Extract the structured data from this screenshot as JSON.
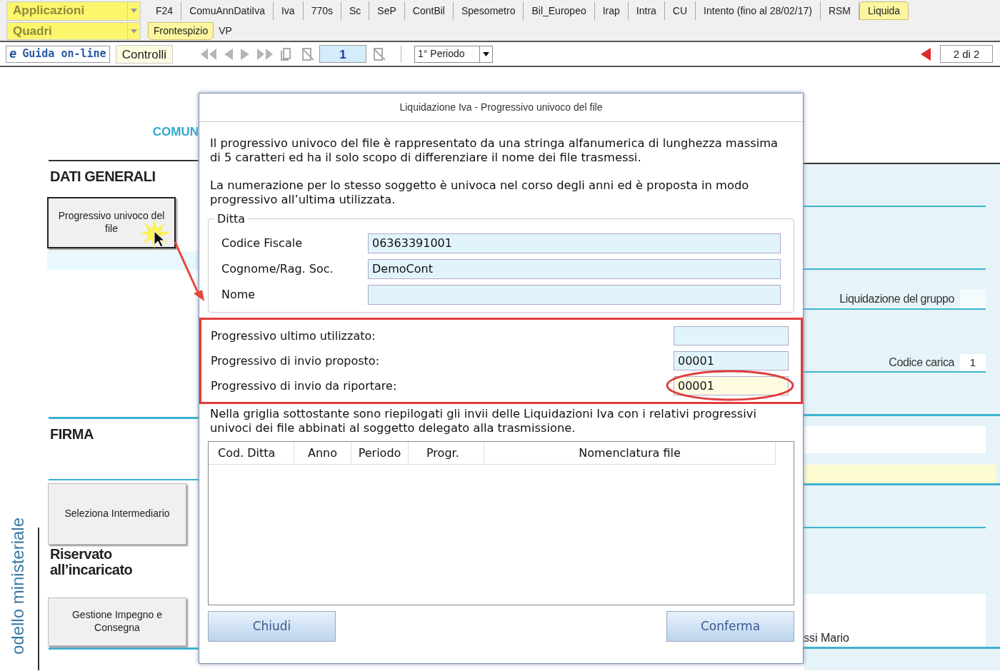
{
  "toolbar": {
    "applications_select": "Applicazioni",
    "sections_select": "Quadri",
    "tabs": [
      {
        "label": "F24",
        "selected": false
      },
      {
        "label": "ComuAnnDatiIva",
        "selected": false
      },
      {
        "label": "Iva",
        "selected": false
      },
      {
        "label": "770s",
        "selected": false
      },
      {
        "label": "Sc",
        "selected": false
      },
      {
        "label": "SeP",
        "selected": false
      },
      {
        "label": "ContBil",
        "selected": false
      },
      {
        "label": "Spesometro",
        "selected": false
      },
      {
        "label": "Bil_Europeo",
        "selected": false
      },
      {
        "label": "Irap",
        "selected": false
      },
      {
        "label": "Intra",
        "selected": false
      },
      {
        "label": "CU",
        "selected": false
      },
      {
        "label": "Intento (fino al 28/02/17)",
        "selected": false
      },
      {
        "label": "RSM",
        "selected": false
      },
      {
        "label": "Liquida",
        "selected": true
      }
    ],
    "sub_tabs": [
      {
        "label": "Frontespizio",
        "selected": true
      },
      {
        "label": "VP",
        "selected": false
      }
    ],
    "help_button": {
      "icon": "e",
      "label": "Guida on-line"
    },
    "checks_button": "Controlli",
    "page_field": "1",
    "period_select": "1° Periodo",
    "page_count": "2 di 2"
  },
  "form": {
    "logo_text": "COMUN",
    "general_title": "DATI GENERALI",
    "progressive_button": "Progressivo univoco del file",
    "signature_title": "FIRMA",
    "intermediary_button": "Seleziona Intermediario",
    "reserved_title": "Riservato all’incaricato",
    "commitment_button": "Gestione Impegno e Consegna",
    "side_label": "odello ministeriale",
    "group_label": "Liquidazione del gruppo",
    "role_label": "Codice carica",
    "role_value": "1",
    "name_fragment": "ssi Mario"
  },
  "dialog": {
    "title": "Liquidazione Iva - Progressivo univoco del file",
    "paragraphs": [
      "Il progressivo univoco del file è rappresentato da una stringa alfanumerica di lunghezza massima di 5 caratteri ed ha il solo scopo di differenziare il nome dei file trasmessi.",
      "La numerazione per lo stesso soggetto è univoca nel corso degli anni ed è proposta in modo progressivo all’ultima utilizzata."
    ],
    "company": {
      "legend": "Ditta",
      "fields": [
        {
          "label": "Codice Fiscale",
          "value": "06363391001"
        },
        {
          "label": "Cognome/Rag. Soc.",
          "value": "DemoCont"
        },
        {
          "label": "Nome"
        }
      ]
    },
    "progressives": [
      {
        "label": "Progressivo ultimo utilizzato:",
        "highlighted": false
      },
      {
        "label": "Progressivo di invio proposto:",
        "value": "00001",
        "highlighted": false
      },
      {
        "label": "Progressivo di invio da riportare:",
        "value": "00001",
        "highlighted": true
      }
    ],
    "grid_note": "Nella griglia sottostante sono riepilogati gli invii delle Liquidazioni Iva con i relativi progressivi univoci dei file abbinati al soggetto delegato alla trasmissione.",
    "columns": [
      "Cod. Ditta",
      "Anno",
      "Periodo",
      "Progr.",
      "Nomenclatura file"
    ],
    "buttons": [
      "Chiudi",
      "Conferma"
    ]
  }
}
